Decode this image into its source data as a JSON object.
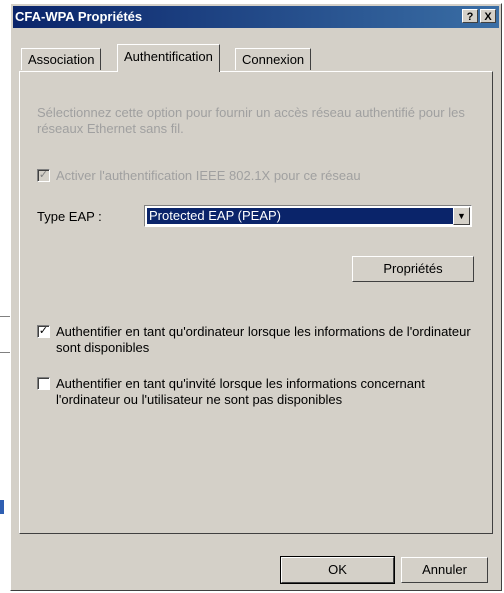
{
  "window": {
    "title": "CFA-WPA Propriétés",
    "help_label": "?",
    "close_label": "X"
  },
  "tabs": [
    {
      "label": "Association",
      "active": false
    },
    {
      "label": "Authentification",
      "active": true
    },
    {
      "label": "Connexion",
      "active": false
    }
  ],
  "auth": {
    "description": "Sélectionnez cette option pour fournir un accès réseau authentifié pour les réseaux Ethernet sans fil.",
    "enable_8021x": {
      "label": "Activer l'authentification IEEE 802.1X pour ce réseau",
      "checked": true,
      "disabled": true,
      "mark": "✓"
    },
    "eap_type_label": "Type EAP :",
    "eap_type_value": "Protected EAP (PEAP)",
    "combo_arrow": "▼",
    "properties_button": "Propriétés",
    "computer_auth": {
      "label": "Authentifier en tant qu'ordinateur lorsque les informations de l'ordinateur sont disponibles",
      "checked": true,
      "mark": "✓"
    },
    "guest_auth": {
      "label": "Authentifier en tant qu'invité lorsque les informations concernant l'ordinateur ou l'utilisateur ne sont pas disponibles",
      "checked": false,
      "mark": ""
    }
  },
  "footer": {
    "ok_label": "OK",
    "cancel_label": "Annuler"
  }
}
